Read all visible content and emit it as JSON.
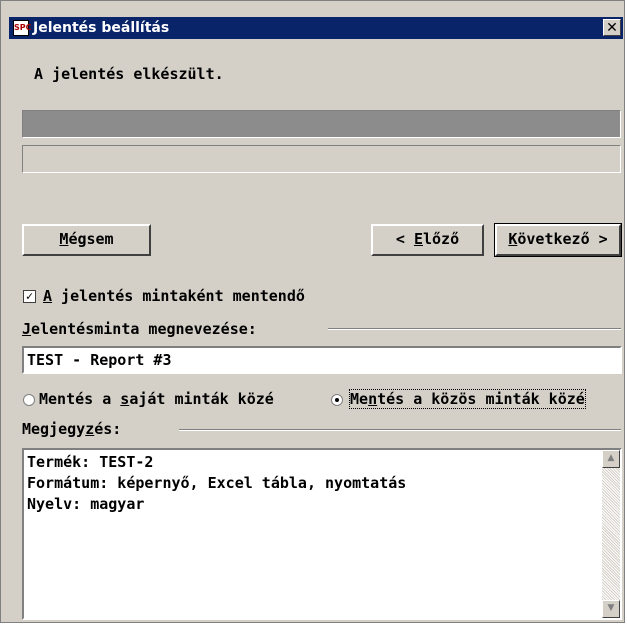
{
  "window": {
    "title": "Jelentés beállítás",
    "app_icon": "spc-icon",
    "close": "✕"
  },
  "status": {
    "message": "A jelentés elkészült.",
    "progress_primary": 1.0,
    "progress_secondary": 0.0
  },
  "buttons": {
    "cancel_pre": "",
    "cancel_u": "M",
    "cancel_post": "égsem",
    "back_pre": "< ",
    "back_u": "E",
    "back_post": "lőző",
    "next_pre": "",
    "next_u": "K",
    "next_post": "övetkező >"
  },
  "save_template": {
    "checked": true,
    "label_u": "A",
    "label_rest": " jelentés mintaként mentendő"
  },
  "template_name": {
    "label_u": "J",
    "label_rest": "elentésminta megnevezése:",
    "value": "TEST - Report #3"
  },
  "radio": {
    "own": {
      "pre": "Mentés a ",
      "u": "s",
      "post": "aját minták közé",
      "selected": false
    },
    "common": {
      "pre": "Me",
      "u": "n",
      "post": "tés a közös minták közé",
      "selected": true
    }
  },
  "notes": {
    "label_pre": "Megjegy",
    "label_u": "z",
    "label_post": "és:",
    "lines": [
      "Termék: TEST-2",
      "Formátum: képernyő, Excel tábla, nyomtatás",
      "Nyelv: magyar"
    ]
  }
}
